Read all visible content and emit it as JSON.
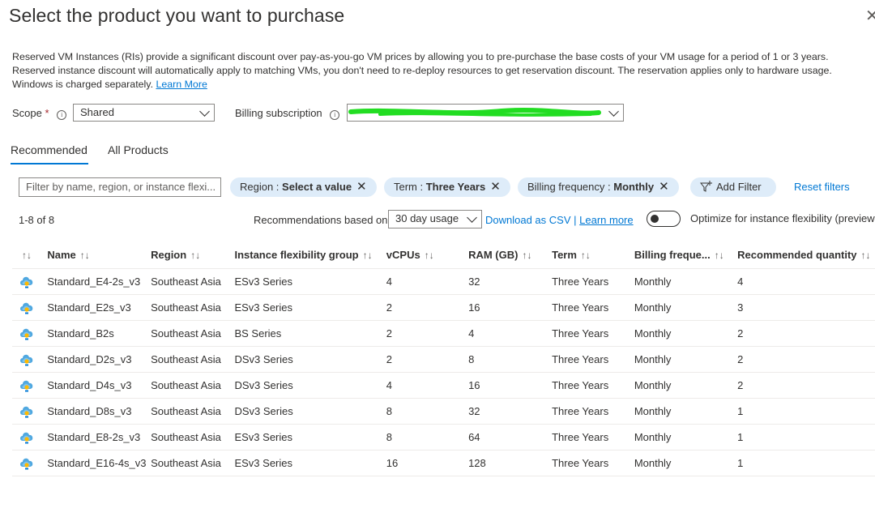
{
  "header": {
    "title": "Select the product you want to purchase",
    "close_glyph": "✕"
  },
  "description": {
    "line1": "Reserved VM Instances (RIs) provide a significant discount over pay-as-you-go VM prices by allowing you to pre-purchase the base costs of your VM usage for a period of 1 or 3 years.",
    "line2": "Reserved instance discount will automatically apply to matching VMs, you don't need to re-deploy resources to get reservation discount. The reservation applies only to hardware usage.",
    "line3": "Windows is charged separately.",
    "learn_more": "Learn More"
  },
  "scope": {
    "label": "Scope",
    "required": "*",
    "value": "Shared"
  },
  "billing_subscription": {
    "label": "Billing subscription",
    "value_redacted": true
  },
  "tabs": [
    {
      "label": "Recommended",
      "active": true
    },
    {
      "label": "All Products",
      "active": false
    }
  ],
  "filters": {
    "search_placeholder": "Filter by name, region, or instance flexi...",
    "region_key": "Region : ",
    "region_value": "Select a value",
    "term_key": "Term : ",
    "term_value": "Three Years",
    "billing_key": "Billing frequency : ",
    "billing_value": "Monthly",
    "add_filter": "Add Filter",
    "reset": "Reset filters"
  },
  "results": {
    "count": "1-8 of 8",
    "based_on_label": "Recommendations based on",
    "usage_value": "30 day usage",
    "download_csv": "Download as CSV",
    "separator": "|",
    "learn_more": "Learn more",
    "optimize_label": "Optimize for instance flexibility (preview"
  },
  "table": {
    "columns": [
      "Name",
      "Region",
      "Instance flexibility group",
      "vCPUs",
      "RAM (GB)",
      "Term",
      "Billing freque...",
      "Recommended quantity"
    ],
    "rows": [
      [
        "Standard_E4-2s_v3",
        "Southeast Asia",
        "ESv3 Series",
        "4",
        "32",
        "Three Years",
        "Monthly",
        "4"
      ],
      [
        "Standard_E2s_v3",
        "Southeast Asia",
        "ESv3 Series",
        "2",
        "16",
        "Three Years",
        "Monthly",
        "3"
      ],
      [
        "Standard_B2s",
        "Southeast Asia",
        "BS Series",
        "2",
        "4",
        "Three Years",
        "Monthly",
        "2"
      ],
      [
        "Standard_D2s_v3",
        "Southeast Asia",
        "DSv3 Series",
        "2",
        "8",
        "Three Years",
        "Monthly",
        "2"
      ],
      [
        "Standard_D4s_v3",
        "Southeast Asia",
        "DSv3 Series",
        "4",
        "16",
        "Three Years",
        "Monthly",
        "2"
      ],
      [
        "Standard_D8s_v3",
        "Southeast Asia",
        "DSv3 Series",
        "8",
        "32",
        "Three Years",
        "Monthly",
        "1"
      ],
      [
        "Standard_E8-2s_v3",
        "Southeast Asia",
        "ESv3 Series",
        "8",
        "64",
        "Three Years",
        "Monthly",
        "1"
      ],
      [
        "Standard_E16-4s_v3",
        "Southeast Asia",
        "ESv3 Series",
        "16",
        "128",
        "Three Years",
        "Monthly",
        "1"
      ]
    ]
  },
  "colors": {
    "accent": "#0078d4",
    "pill_bg": "#deecf9",
    "redaction": "#22dd22",
    "vm_icon": "#50a8e0"
  },
  "icons": {
    "sort": "sort-arrows-icon",
    "vm": "virtual-machine-icon",
    "info": "info-icon",
    "filter": "add-filter-icon"
  }
}
